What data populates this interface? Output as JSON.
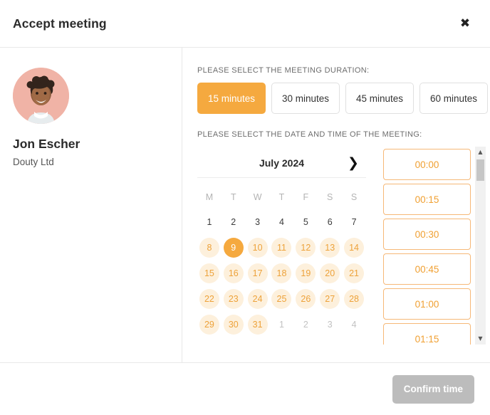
{
  "header": {
    "title": "Accept meeting",
    "close_icon": "close-icon",
    "close_glyph": "✖"
  },
  "profile": {
    "name": "Jon Escher",
    "company": "Douty Ltd",
    "avatar_icon": "avatar"
  },
  "duration": {
    "label": "PLEASE SELECT THE MEETING DURATION:",
    "options": [
      {
        "label": "15 minutes",
        "selected": true
      },
      {
        "label": "30 minutes",
        "selected": false
      },
      {
        "label": "45 minutes",
        "selected": false
      },
      {
        "label": "60 minutes",
        "selected": false
      }
    ]
  },
  "datetime": {
    "label": "PLEASE SELECT THE DATE AND TIME OF THE MEETING:"
  },
  "calendar": {
    "month": "July 2024",
    "next_icon": "chevron-right-icon",
    "next_glyph": "❯",
    "weekdays": [
      "M",
      "T",
      "W",
      "T",
      "F",
      "S",
      "S"
    ],
    "days": [
      {
        "label": "1",
        "state": "past"
      },
      {
        "label": "2",
        "state": "past"
      },
      {
        "label": "3",
        "state": "past"
      },
      {
        "label": "4",
        "state": "past"
      },
      {
        "label": "5",
        "state": "past"
      },
      {
        "label": "6",
        "state": "past"
      },
      {
        "label": "7",
        "state": "past"
      },
      {
        "label": "8",
        "state": "avail"
      },
      {
        "label": "9",
        "state": "selected"
      },
      {
        "label": "10",
        "state": "avail"
      },
      {
        "label": "11",
        "state": "avail"
      },
      {
        "label": "12",
        "state": "avail"
      },
      {
        "label": "13",
        "state": "avail"
      },
      {
        "label": "14",
        "state": "avail"
      },
      {
        "label": "15",
        "state": "avail"
      },
      {
        "label": "16",
        "state": "avail"
      },
      {
        "label": "17",
        "state": "avail"
      },
      {
        "label": "18",
        "state": "avail"
      },
      {
        "label": "19",
        "state": "avail"
      },
      {
        "label": "20",
        "state": "avail"
      },
      {
        "label": "21",
        "state": "avail"
      },
      {
        "label": "22",
        "state": "avail"
      },
      {
        "label": "23",
        "state": "avail"
      },
      {
        "label": "24",
        "state": "avail"
      },
      {
        "label": "25",
        "state": "avail"
      },
      {
        "label": "26",
        "state": "avail"
      },
      {
        "label": "27",
        "state": "avail"
      },
      {
        "label": "28",
        "state": "avail"
      },
      {
        "label": "29",
        "state": "avail"
      },
      {
        "label": "30",
        "state": "avail"
      },
      {
        "label": "31",
        "state": "avail"
      },
      {
        "label": "1",
        "state": "outside"
      },
      {
        "label": "2",
        "state": "outside"
      },
      {
        "label": "3",
        "state": "outside"
      },
      {
        "label": "4",
        "state": "outside"
      }
    ]
  },
  "times": {
    "slots": [
      "00:00",
      "00:15",
      "00:30",
      "00:45",
      "01:00",
      "01:15"
    ],
    "scrollbar": {
      "up_icon": "scroll-up-arrow-icon",
      "up_glyph": "▲",
      "down_icon": "scroll-down-arrow-icon",
      "down_glyph": "▼"
    }
  },
  "footer": {
    "confirm_label": "Confirm time",
    "confirm_disabled": true
  },
  "colors": {
    "accent": "#f5a93f",
    "accent_soft": "#fdf0dc",
    "accent_border": "#f6b877",
    "disabled": "#bcbcbc",
    "avatar_bg": "#f0b3a6"
  }
}
